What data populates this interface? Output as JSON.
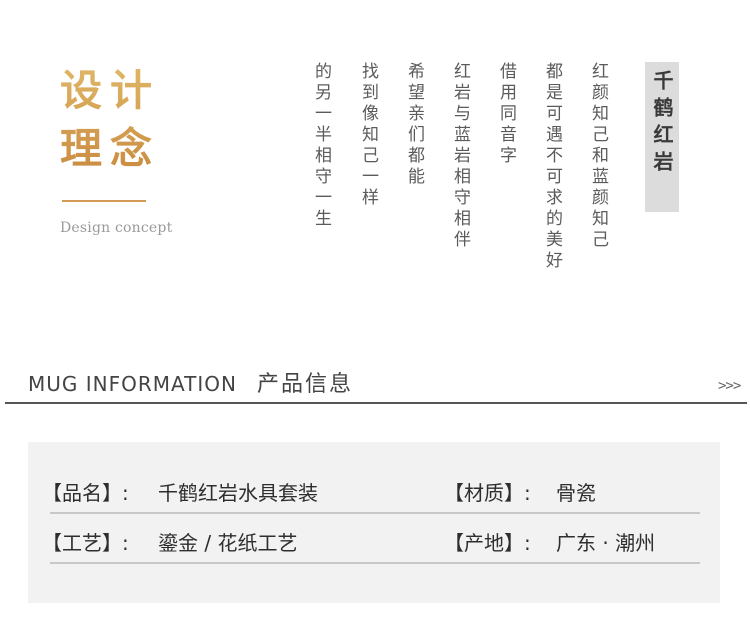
{
  "concept": {
    "title_line1": "设计",
    "title_line2": "理念",
    "subtitle": "Design concept"
  },
  "poem": {
    "title": "千鹤红岩",
    "columns": [
      "红颜知己和蓝颜知己",
      "都是可遇不可求的美好",
      "借用同音字",
      "红岩与蓝岩相守相伴",
      "希望亲们都能",
      "找到像知己一样",
      "的另一半相守一生"
    ]
  },
  "section": {
    "title_en": "MUG  INFORMATION",
    "title_cn": "产品信息",
    "arrows": ">>>"
  },
  "info": {
    "rows": [
      {
        "label1": "【品名】:",
        "value1": "千鹤红岩水具套装",
        "label2": "【材质】:",
        "value2": "骨瓷"
      },
      {
        "label1": "【工艺】:",
        "value1": "鎏金 / 花纸工艺",
        "label2": "【产地】:",
        "value2": "广东 · 潮州"
      }
    ]
  },
  "colors": {
    "gold": "#d1a257",
    "text": "#2e2e2e",
    "panel": "#f2f2f2",
    "rule": "#555555"
  }
}
